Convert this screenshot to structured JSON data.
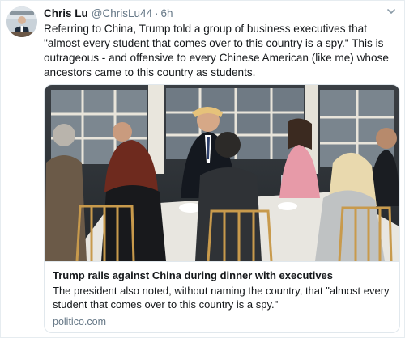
{
  "tweet": {
    "author_name": "Chris Lu",
    "handle": "@ChrisLu44",
    "separator": "·",
    "time": "6h",
    "text": "Referring to China, Trump told a group of business executives that \"almost every student that comes over to this country is a spy.\" This is outrageous - and offensive to every Chinese American (like me) whose ancestors came to this country as students."
  },
  "card": {
    "title": "Trump rails against China during dinner with executives",
    "description": "The president also noted, without naming the country, that \"almost every student that comes over to this country is a spy.\"",
    "domain": "politico.com"
  },
  "icons": {
    "menu": "chevron-down-icon"
  },
  "colors": {
    "text_primary": "#14171a",
    "text_secondary": "#657786",
    "border": "#e1e8ed"
  }
}
